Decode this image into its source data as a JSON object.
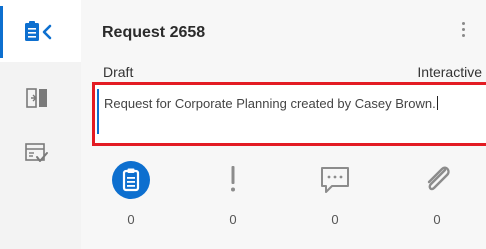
{
  "rail": {
    "items": [
      {
        "icon": "clipboard-collapse-icon",
        "active": true
      },
      {
        "icon": "panel-toggle-icon",
        "active": false
      },
      {
        "icon": "checklist-icon",
        "active": false
      }
    ]
  },
  "header": {
    "title": "Request 2658",
    "menu_icon": "kebab-menu-icon"
  },
  "info": {
    "status": "Draft",
    "mode": "Interactive"
  },
  "description": {
    "text": "Request for Corporate Planning created by Casey Brown."
  },
  "tabs": [
    {
      "icon": "clipboard-icon",
      "count": "0",
      "active": true
    },
    {
      "icon": "exclamation-icon",
      "count": "0",
      "active": false
    },
    {
      "icon": "comment-icon",
      "count": "0",
      "active": false
    },
    {
      "icon": "paperclip-icon",
      "count": "0",
      "active": false
    }
  ],
  "colors": {
    "accent": "#0d6fcf",
    "highlight": "#e31b23"
  }
}
